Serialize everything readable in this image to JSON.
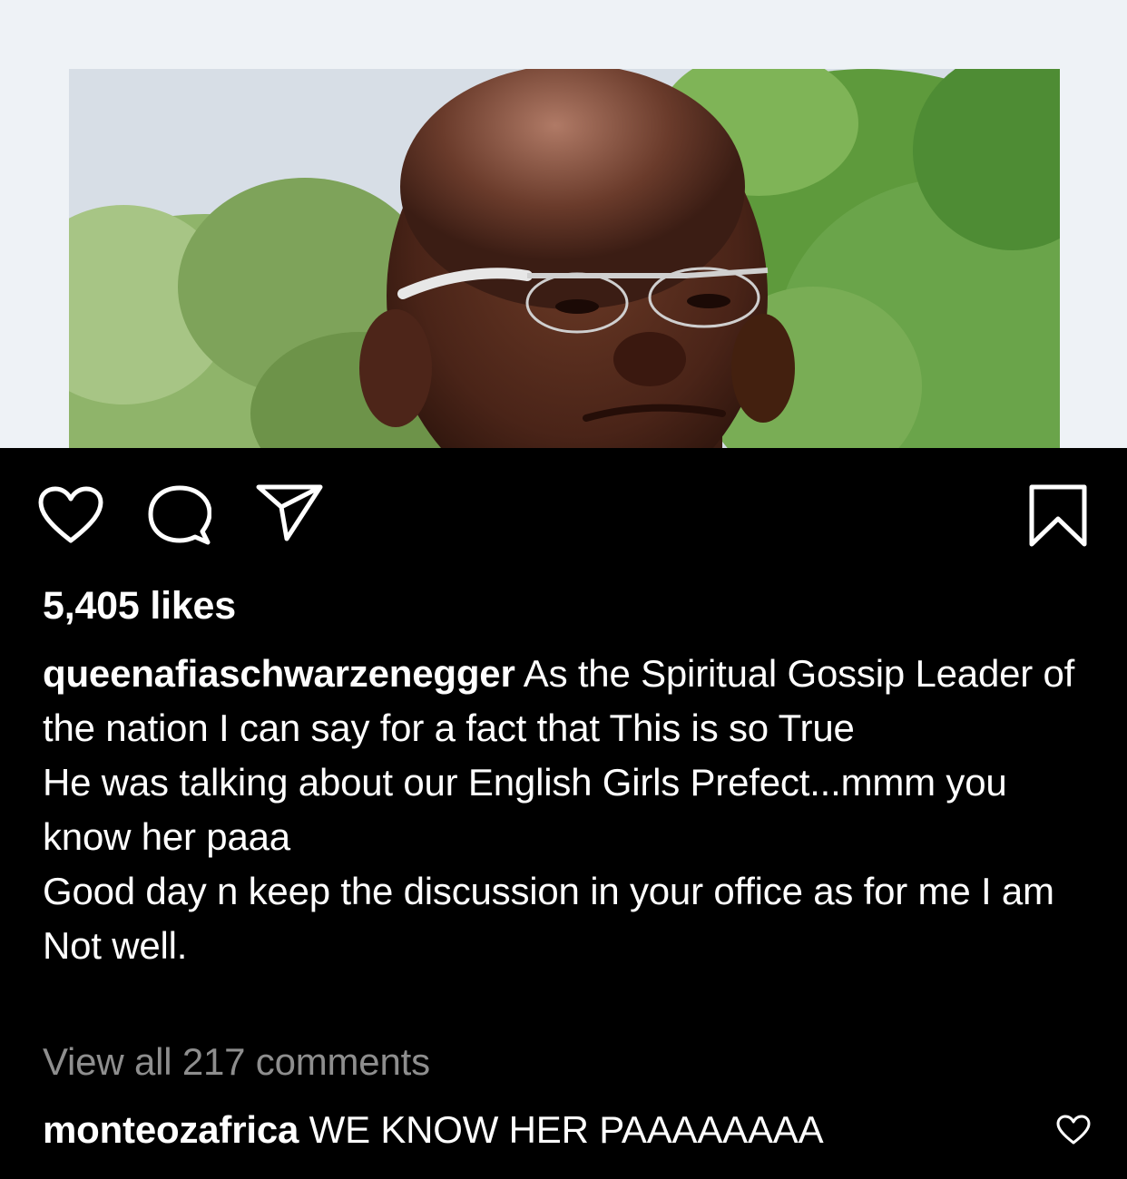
{
  "post": {
    "image": {
      "alt_subject": "portrait-photo"
    },
    "actions": {
      "like_icon": "heart-icon",
      "comment_icon": "comment-bubble-icon",
      "share_icon": "paper-plane-icon",
      "save_icon": "bookmark-icon"
    },
    "likes_text": "5,405 likes",
    "caption": {
      "username": "queenafiaschwarzenegger",
      "lines": [
        "As the Spiritual Gossip Leader of the nation I can say for a fact that This is so  True",
        "He was talking about our English Girls Prefect...mmm you know her paaa",
        "Good day n keep the discussion in your office as for me I am Not well."
      ]
    },
    "view_all_comments": "View all 217 comments",
    "comments": [
      {
        "username": "monteozafrica",
        "text": "WE KNOW HER PAAAAAAAA",
        "like_icon": "heart-outline-icon"
      }
    ]
  },
  "colors": {
    "background": "#000000",
    "text": "#ffffff",
    "muted": "#8e8e8e",
    "photo_frame": "#eef2f6"
  }
}
